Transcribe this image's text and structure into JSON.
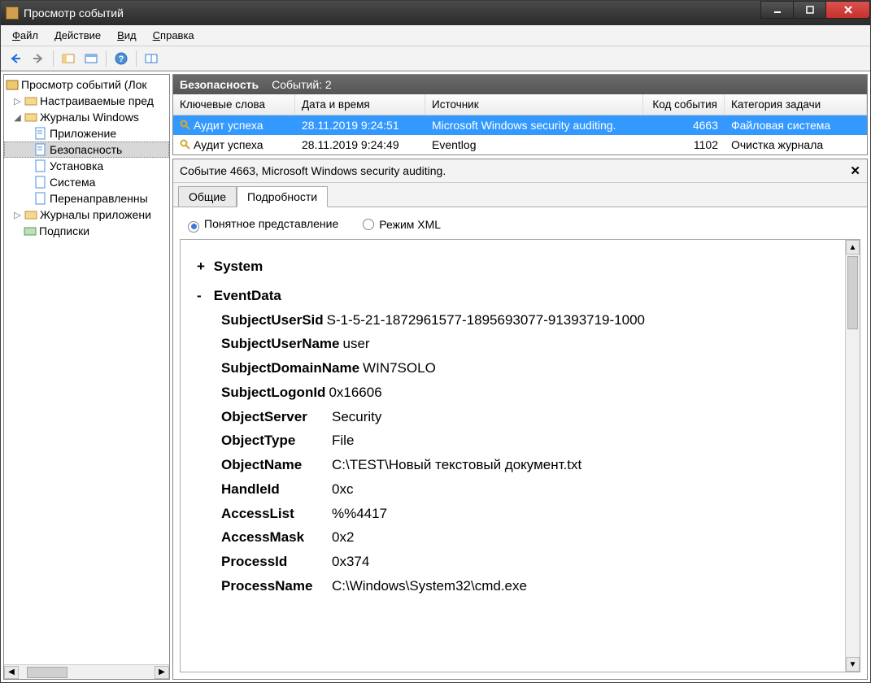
{
  "window": {
    "title": "Просмотр событий"
  },
  "menu": {
    "file": "Файл",
    "action": "Действие",
    "view": "Вид",
    "help": "Справка"
  },
  "tree": {
    "root": "Просмотр событий (Лок",
    "custom": "Настраиваемые пред",
    "winlogs": "Журналы Windows",
    "app": "Приложение",
    "security": "Безопасность",
    "setup": "Установка",
    "system": "Система",
    "forwarded": "Перенаправленны",
    "applogs": "Журналы приложени",
    "subs": "Подписки"
  },
  "list": {
    "title": "Безопасность",
    "count_label": "Событий: 2",
    "cols": {
      "kw": "Ключевые слова",
      "dt": "Дата и время",
      "src": "Источник",
      "id": "Код события",
      "cat": "Категория задачи"
    },
    "rows": [
      {
        "kw": "Аудит успеха",
        "dt": "28.11.2019 9:24:51",
        "src": "Microsoft Windows security auditing.",
        "id": "4663",
        "cat": "Файловая система"
      },
      {
        "kw": "Аудит успеха",
        "dt": "28.11.2019 9:24:49",
        "src": "Eventlog",
        "id": "1102",
        "cat": "Очистка журнала"
      }
    ]
  },
  "detail": {
    "header": "Событие 4663, Microsoft Windows security auditing.",
    "tabs": {
      "general": "Общие",
      "details": "Подробности"
    },
    "view": {
      "friendly": "Понятное представление",
      "xml": "Режим XML"
    },
    "system_label": "System",
    "eventdata_label": "EventData",
    "data": {
      "SubjectUserSid": "S-1-5-21-1872961577-1895693077-91393719-1000",
      "SubjectUserName": "user",
      "SubjectDomainName": "WIN7SOLO",
      "SubjectLogonId": "0x16606",
      "ObjectServer": "Security",
      "ObjectType": "File",
      "ObjectName": "C:\\TEST\\Новый текстовый документ.txt",
      "HandleId": "0xc",
      "AccessList": "%%4417",
      "AccessMask": "0x2",
      "ProcessId": "0x374",
      "ProcessName": "C:\\Windows\\System32\\cmd.exe"
    },
    "keys": {
      "SubjectUserSid": "SubjectUserSid",
      "SubjectUserName": "SubjectUserName",
      "SubjectDomainName": "SubjectDomainName",
      "SubjectLogonId": "SubjectLogonId",
      "ObjectServer": "ObjectServer",
      "ObjectType": "ObjectType",
      "ObjectName": "ObjectName",
      "HandleId": "HandleId",
      "AccessList": "AccessList",
      "AccessMask": "AccessMask",
      "ProcessId": "ProcessId",
      "ProcessName": "ProcessName"
    }
  }
}
